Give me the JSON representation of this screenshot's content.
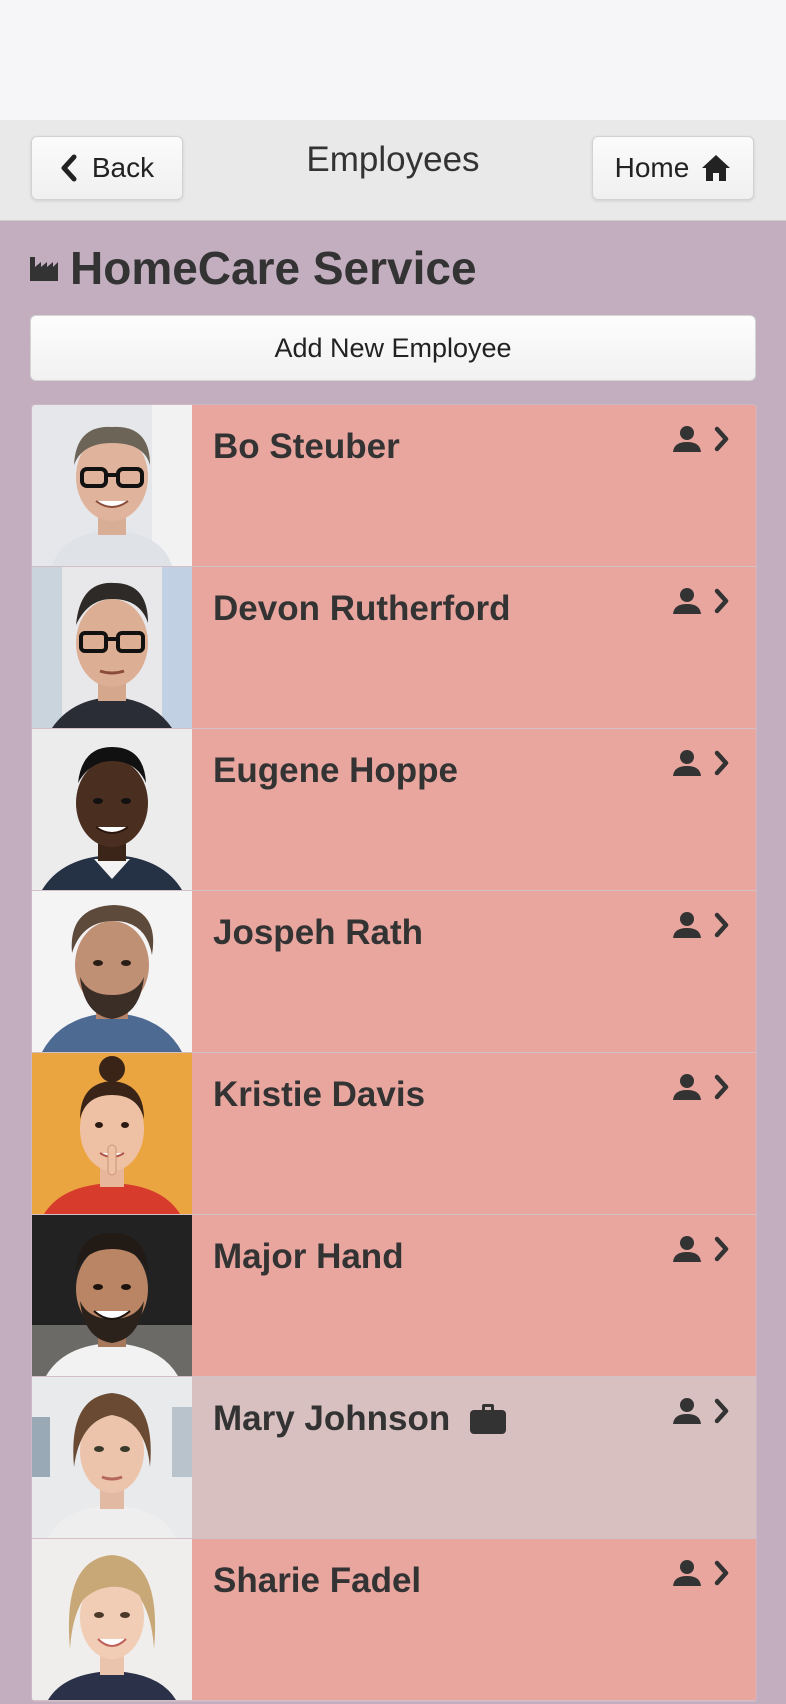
{
  "header": {
    "title": "Employees",
    "back_label": "Back",
    "home_label": "Home"
  },
  "company": {
    "name": "HomeCare Service"
  },
  "add_button_label": "Add New Employee",
  "employees": [
    {
      "name": "Bo Steuber",
      "highlight": false
    },
    {
      "name": "Devon Rutherford",
      "highlight": false
    },
    {
      "name": "Eugene Hoppe",
      "highlight": false
    },
    {
      "name": "Jospeh Rath",
      "highlight": false
    },
    {
      "name": "Kristie Davis",
      "highlight": false
    },
    {
      "name": "Major Hand",
      "highlight": false
    },
    {
      "name": "Mary Johnson",
      "highlight": true,
      "badge_icon": "briefcase-icon"
    },
    {
      "name": "Sharie Fadel",
      "highlight": false
    }
  ],
  "colors": {
    "background": "#c3aec0",
    "row": "#e8a69f",
    "row_highlight": "#d8c0c0",
    "header": "#e9e9e9"
  }
}
